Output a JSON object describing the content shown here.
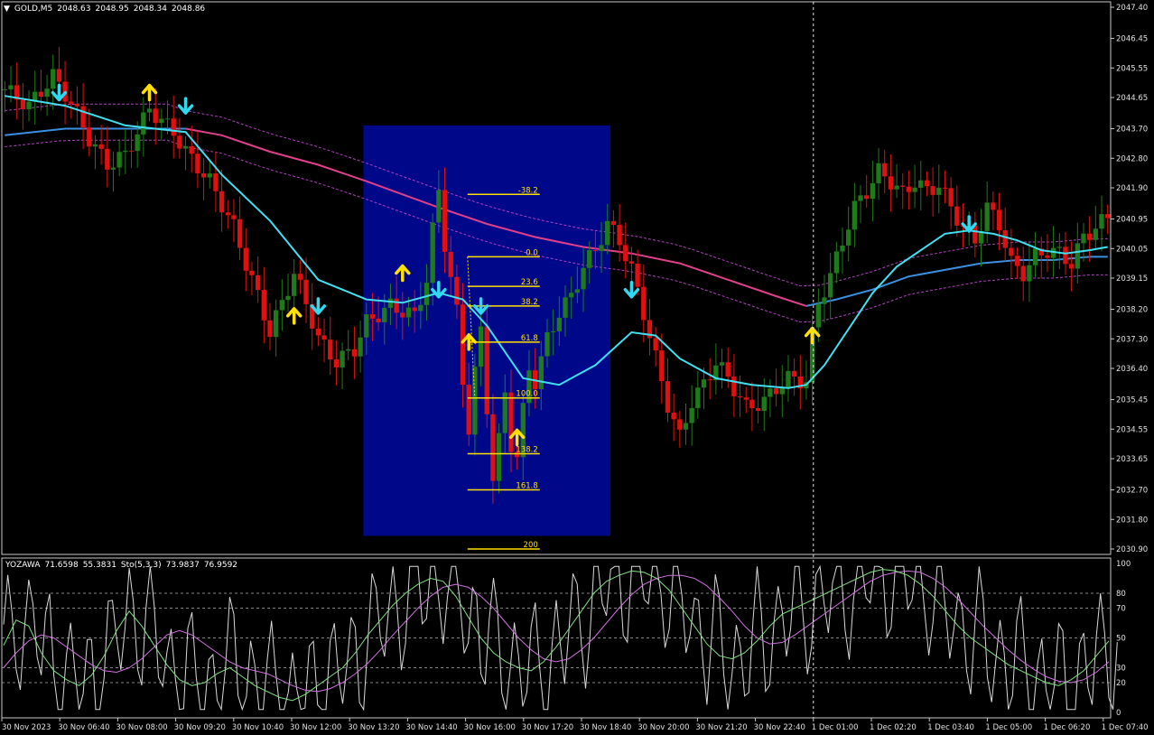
{
  "window": {
    "symbol_label": "GOLD,M5",
    "ohlc": [
      "2048.63",
      "2048.95",
      "2048.34",
      "2048.86"
    ],
    "menu_icon": "triangle-down-icon"
  },
  "indicator": {
    "name": "YOZAWA",
    "values": [
      "71.6598",
      "55.3831"
    ],
    "stoch_label": "Sto(5,3,3)",
    "stoch_values": [
      "73.9837",
      "76.9592"
    ]
  },
  "colors": {
    "background": "#000000",
    "bull_bar": "#1f7a1a",
    "bear_bar": "#e01010",
    "fast_ma": "#40e0f0",
    "mid_ma": "#3a8fe0",
    "slow_ma": "#e0408a",
    "envelope": "#b040c0",
    "zone": "#00088a",
    "fib": "#ffe000",
    "arrow_up": "#ffe000",
    "arrow_down": "#30d8f0",
    "stoch_main": "#80e080",
    "stoch_signal": "#d070e0",
    "osc_white": "#d8d8d8"
  },
  "chart_data": [
    {
      "type": "bar",
      "title": "GOLD,M5",
      "price_ticks": [
        "2047.40",
        "2046.45",
        "2045.55",
        "2044.65",
        "2043.70",
        "2042.80",
        "2041.90",
        "2040.95",
        "2040.05",
        "2039.15",
        "2038.20",
        "2037.30",
        "2036.40",
        "2035.45",
        "2034.55",
        "2033.65",
        "2032.70",
        "2031.80",
        "2030.90"
      ],
      "ylim": [
        2030.9,
        2047.4
      ],
      "time_ticks": [
        "30 Nov 2023",
        "30 Nov 06:40",
        "30 Nov 08:00",
        "30 Nov 09:20",
        "30 Nov 10:40",
        "30 Nov 12:00",
        "30 Nov 13:20",
        "30 Nov 14:40",
        "30 Nov 16:00",
        "30 Nov 17:20",
        "30 Nov 18:40",
        "30 Nov 20:00",
        "30 Nov 21:20",
        "30 Nov 22:40",
        "1 Dec 01:00",
        "1 Dec 02:20",
        "1 Dec 03:40",
        "1 Dec 05:00",
        "1 Dec 06:20",
        "1 Dec 07:40"
      ],
      "current_time_marker": "1 Dec 01:00",
      "close_path": [
        [
          0,
          2044.9
        ],
        [
          4,
          2044.4
        ],
        [
          8,
          2045.3
        ],
        [
          11,
          2044.5
        ],
        [
          14,
          2043.4
        ],
        [
          17,
          2042.6
        ],
        [
          20,
          2042.9
        ],
        [
          24,
          2044.3
        ],
        [
          28,
          2043.6
        ],
        [
          30,
          2043.0
        ],
        [
          34,
          2042.1
        ],
        [
          36,
          2041.4
        ],
        [
          38,
          2040.7
        ],
        [
          40,
          2039.6
        ],
        [
          42,
          2038.6
        ],
        [
          44,
          2037.5
        ],
        [
          46,
          2038.4
        ],
        [
          48,
          2039.3
        ],
        [
          50,
          2038.4
        ],
        [
          52,
          2037.3
        ],
        [
          55,
          2036.6
        ],
        [
          58,
          2037.0
        ],
        [
          60,
          2037.8
        ],
        [
          64,
          2038.3
        ],
        [
          68,
          2038.0
        ],
        [
          70,
          2039.1
        ],
        [
          71,
          2040.6
        ],
        [
          72,
          2041.8
        ],
        [
          73,
          2040.2
        ],
        [
          75,
          2038.1
        ],
        [
          76,
          2036.0
        ],
        [
          77,
          2034.6
        ],
        [
          78,
          2036.3
        ],
        [
          79,
          2037.5
        ],
        [
          80,
          2035.2
        ],
        [
          81,
          2033.1
        ],
        [
          82,
          2034.2
        ],
        [
          83,
          2035.6
        ],
        [
          84,
          2034.1
        ],
        [
          85,
          2033.7
        ],
        [
          86,
          2035.1
        ],
        [
          87,
          2036.4
        ],
        [
          88,
          2036.0
        ],
        [
          90,
          2037.3
        ],
        [
          92,
          2038.1
        ],
        [
          94,
          2038.6
        ],
        [
          96,
          2039.5
        ],
        [
          98,
          2040.0
        ],
        [
          100,
          2040.8
        ],
        [
          102,
          2040.3
        ],
        [
          104,
          2039.4
        ],
        [
          106,
          2038.1
        ],
        [
          108,
          2036.7
        ],
        [
          110,
          2035.3
        ],
        [
          112,
          2034.3
        ],
        [
          114,
          2035.4
        ],
        [
          116,
          2035.9
        ],
        [
          118,
          2036.6
        ],
        [
          120,
          2036.1
        ],
        [
          123,
          2035.2
        ],
        [
          126,
          2035.4
        ],
        [
          128,
          2035.8
        ],
        [
          130,
          2036.1
        ],
        [
          133,
          2036.0
        ],
        [
          134,
          2037.4
        ],
        [
          135,
          2038.4
        ],
        [
          137,
          2039.2
        ],
        [
          139,
          2040.3
        ],
        [
          141,
          2041.3
        ],
        [
          143,
          2041.8
        ],
        [
          145,
          2042.4
        ],
        [
          147,
          2042.1
        ],
        [
          149,
          2041.7
        ],
        [
          151,
          2042.1
        ],
        [
          153,
          2041.8
        ],
        [
          155,
          2042.0
        ],
        [
          157,
          2041.3
        ],
        [
          159,
          2040.7
        ],
        [
          161,
          2040.3
        ],
        [
          163,
          2041.3
        ],
        [
          165,
          2040.8
        ],
        [
          167,
          2039.6
        ],
        [
          169,
          2039.3
        ],
        [
          171,
          2039.8
        ],
        [
          173,
          2040.0
        ],
        [
          175,
          2039.9
        ],
        [
          177,
          2039.6
        ],
        [
          179,
          2040.4
        ],
        [
          181,
          2040.7
        ],
        [
          183,
          2041.0
        ]
      ],
      "ma_fast": [
        [
          0,
          2044.7
        ],
        [
          10,
          2044.4
        ],
        [
          20,
          2043.8
        ],
        [
          30,
          2043.6
        ],
        [
          36,
          2042.3
        ],
        [
          44,
          2040.9
        ],
        [
          52,
          2039.1
        ],
        [
          60,
          2038.5
        ],
        [
          66,
          2038.4
        ],
        [
          72,
          2038.7
        ],
        [
          76,
          2038.5
        ],
        [
          80,
          2037.7
        ],
        [
          86,
          2036.1
        ],
        [
          92,
          2035.9
        ],
        [
          98,
          2036.5
        ],
        [
          104,
          2037.5
        ],
        [
          108,
          2037.4
        ],
        [
          112,
          2036.7
        ],
        [
          118,
          2036.1
        ],
        [
          124,
          2035.9
        ],
        [
          130,
          2035.8
        ],
        [
          133,
          2035.9
        ],
        [
          136,
          2036.5
        ],
        [
          140,
          2037.6
        ],
        [
          144,
          2038.7
        ],
        [
          148,
          2039.5
        ],
        [
          152,
          2040.0
        ],
        [
          156,
          2040.5
        ],
        [
          160,
          2040.6
        ],
        [
          164,
          2040.5
        ],
        [
          168,
          2040.3
        ],
        [
          172,
          2040.0
        ],
        [
          176,
          2039.9
        ],
        [
          180,
          2040.0
        ],
        [
          183,
          2040.1
        ]
      ],
      "ma_mid": [
        [
          0,
          2043.5
        ],
        [
          10,
          2043.7
        ],
        [
          20,
          2043.7
        ],
        [
          26,
          2043.7
        ],
        [
          30,
          2043.7
        ]
      ],
      "ma_mid_tail": [
        [
          133,
          2038.3
        ],
        [
          138,
          2038.5
        ],
        [
          144,
          2038.8
        ],
        [
          150,
          2039.2
        ],
        [
          156,
          2039.4
        ],
        [
          162,
          2039.6
        ],
        [
          168,
          2039.7
        ],
        [
          174,
          2039.7
        ],
        [
          180,
          2039.8
        ],
        [
          183,
          2039.8
        ]
      ],
      "ma_slow": [
        [
          30,
          2043.7
        ],
        [
          36,
          2043.5
        ],
        [
          44,
          2043.0
        ],
        [
          52,
          2042.6
        ],
        [
          60,
          2042.1
        ],
        [
          66,
          2041.7
        ],
        [
          72,
          2041.3
        ],
        [
          80,
          2040.8
        ],
        [
          88,
          2040.4
        ],
        [
          96,
          2040.1
        ],
        [
          104,
          2039.9
        ],
        [
          112,
          2039.6
        ],
        [
          120,
          2039.1
        ],
        [
          128,
          2038.6
        ],
        [
          133,
          2038.3
        ]
      ],
      "fib_levels": [
        {
          "label": "-38.2",
          "price": 2041.7
        },
        {
          "label": "0.0",
          "price": 2039.8
        },
        {
          "label": "23.6",
          "price": 2038.9
        },
        {
          "label": "38.2",
          "price": 2038.3
        },
        {
          "label": "61.8",
          "price": 2037.2
        },
        {
          "label": "100.0",
          "price": 2035.5
        },
        {
          "label": "138.2",
          "price": 2033.8
        },
        {
          "label": "161.8",
          "price": 2032.7
        },
        {
          "label": "200",
          "price": 2030.9
        }
      ],
      "up_arrows": [
        [
          24,
          2044.8
        ],
        [
          48,
          2038.0
        ],
        [
          66,
          2039.3
        ],
        [
          77,
          2037.2
        ],
        [
          85,
          2034.3
        ],
        [
          134,
          2037.4
        ]
      ],
      "down_arrows": [
        [
          9,
          2044.8
        ],
        [
          30,
          2044.4
        ],
        [
          52,
          2038.3
        ],
        [
          72,
          2038.8
        ],
        [
          79,
          2038.3
        ],
        [
          104,
          2038.8
        ],
        [
          160,
          2040.8
        ]
      ],
      "zone": {
        "start_bar": 60,
        "end_bar": 101,
        "price_top": 2043.8,
        "price_bottom": 2031.3
      }
    },
    {
      "type": "line",
      "title": "YOZAWA",
      "levels": [
        "100",
        "80",
        "70",
        "50",
        "30",
        "20",
        "0"
      ],
      "ylim": [
        0,
        100
      ],
      "main_values": [
        45,
        62,
        58,
        40,
        28,
        22,
        18,
        25,
        38,
        55,
        68,
        58,
        45,
        32,
        22,
        18,
        20,
        26,
        30,
        24,
        18,
        14,
        10,
        8,
        12,
        18,
        24,
        30,
        40,
        52,
        62,
        72,
        80,
        86,
        90,
        88,
        78,
        64,
        50,
        40,
        34,
        30,
        28,
        34,
        44,
        56,
        68,
        80,
        88,
        92,
        95,
        94,
        90,
        82,
        70,
        58,
        46,
        38,
        36,
        40,
        48,
        58,
        66,
        70,
        74,
        78,
        82,
        86,
        90,
        94,
        96,
        95,
        92,
        86,
        78,
        68,
        58,
        50,
        44,
        38,
        32,
        28,
        24,
        20,
        18,
        22,
        28,
        38,
        48
      ],
      "signal_values": [
        30,
        40,
        48,
        52,
        50,
        44,
        38,
        32,
        28,
        27,
        30,
        36,
        44,
        52,
        55,
        52,
        46,
        40,
        34,
        30,
        28,
        26,
        22,
        18,
        15,
        14,
        16,
        20,
        26,
        33,
        42,
        52,
        61,
        70,
        78,
        84,
        86,
        84,
        78,
        70,
        60,
        50,
        42,
        36,
        34,
        36,
        42,
        50,
        60,
        70,
        79,
        86,
        90,
        92,
        92,
        90,
        85,
        77,
        68,
        58,
        50,
        46,
        47,
        52,
        58,
        64,
        70,
        76,
        82,
        88,
        92,
        94,
        95,
        94,
        90,
        84,
        76,
        67,
        58,
        50,
        42,
        35,
        29,
        24,
        21,
        20,
        22,
        27,
        34
      ]
    }
  ]
}
